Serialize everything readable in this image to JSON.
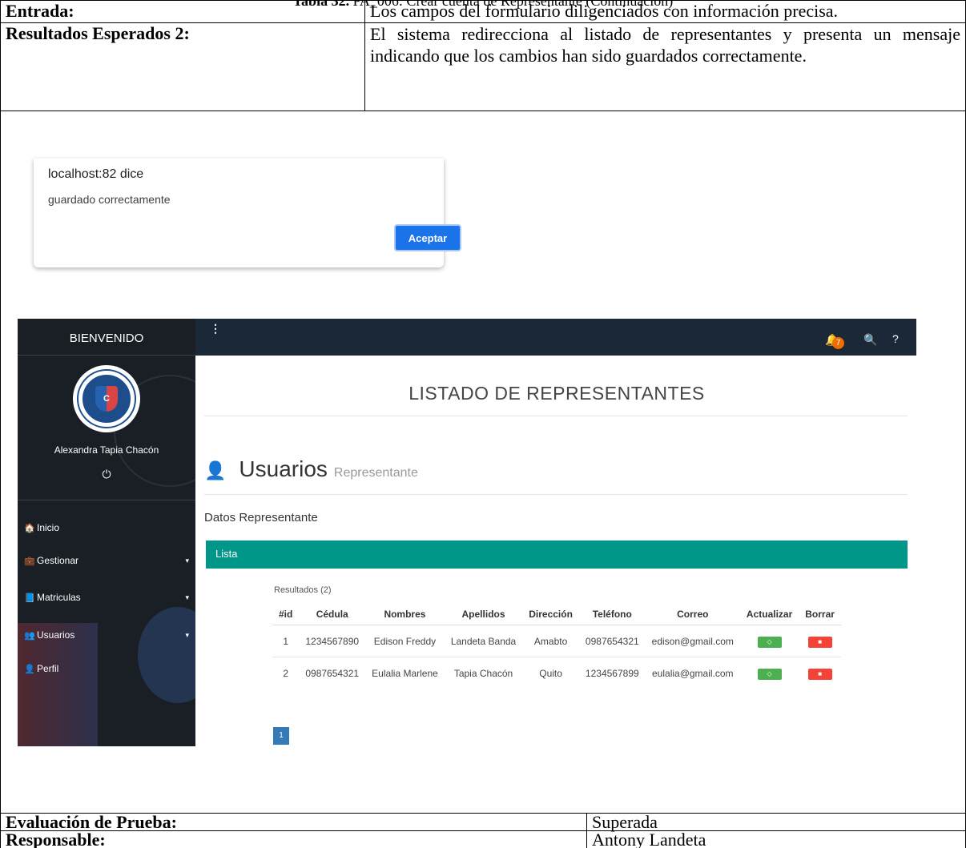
{
  "caption": {
    "bold": "Tabla 32.",
    "text": " PA_006: Crear cuenta de Representante (Continuación)"
  },
  "rows": {
    "entrada_label": "Entrada:",
    "entrada_value": "Los campos del formulario diligenciados con información precisa.",
    "resultados_label": "Resultados Esperados 2:",
    "resultados_value": "El sistema redirecciona al listado de representantes y presenta un mensaje indicando que los cambios han sido guardados correctamente.",
    "evaluacion_label": "Evaluación de Prueba:",
    "evaluacion_value": "Superada",
    "responsable_label": "Responsable:",
    "responsable_value": "Antony Landeta"
  },
  "dialog": {
    "host": "localhost:82 dice",
    "message": "guardado correctamente",
    "ok_label": "Aceptar"
  },
  "sidebar": {
    "welcome": "BIENVENIDO",
    "logo_text": "C",
    "user_name": "Alexandra Tapia Chacón",
    "power_icon": "⏻",
    "items": [
      {
        "icon": "🏠",
        "label": "Inicio",
        "caret": ""
      },
      {
        "icon": "💼",
        "label": "Gestionar",
        "caret": "▾"
      },
      {
        "icon": "📘",
        "label": "Matriculas",
        "caret": "▾"
      },
      {
        "icon": "👥",
        "label": "Usuarios",
        "caret": "▾"
      },
      {
        "icon": "👤",
        "label": "Perfil",
        "caret": ""
      }
    ]
  },
  "topbar": {
    "menu_icon": "⋮",
    "bell_icon": "🔔",
    "badge_count": "7",
    "search_icon": "🔍",
    "help_icon": "?"
  },
  "main": {
    "title": "LISTADO DE REPRESENTANTES",
    "section_title": "Usuarios",
    "section_subtitle": "Representante",
    "datos_label": "Datos Representante",
    "lista_label": "Lista",
    "results_label": "Resultados (2)",
    "columns": [
      "#id",
      "Cédula",
      "Nombres",
      "Apellidos",
      "Dirección",
      "Teléfono",
      "Correo",
      "Actualizar",
      "Borrar"
    ],
    "rows": [
      [
        "1",
        "1234567890",
        "Edison Freddy",
        "Landeta Banda",
        "Amabto",
        "0987654321",
        "edison@gmail.com"
      ],
      [
        "2",
        "0987654321",
        "Eulalia Marlene",
        "Tapia Chacón",
        "Quito",
        "1234567899",
        "eulalia@gmail.com"
      ]
    ],
    "page_number": "1"
  },
  "colors": {
    "teal": "#009688",
    "topbar": "#1b2837",
    "sidebar": "#1a1f26",
    "update": "#4caf50",
    "delete": "#f44336",
    "dialog_button": "#1a73e8"
  }
}
